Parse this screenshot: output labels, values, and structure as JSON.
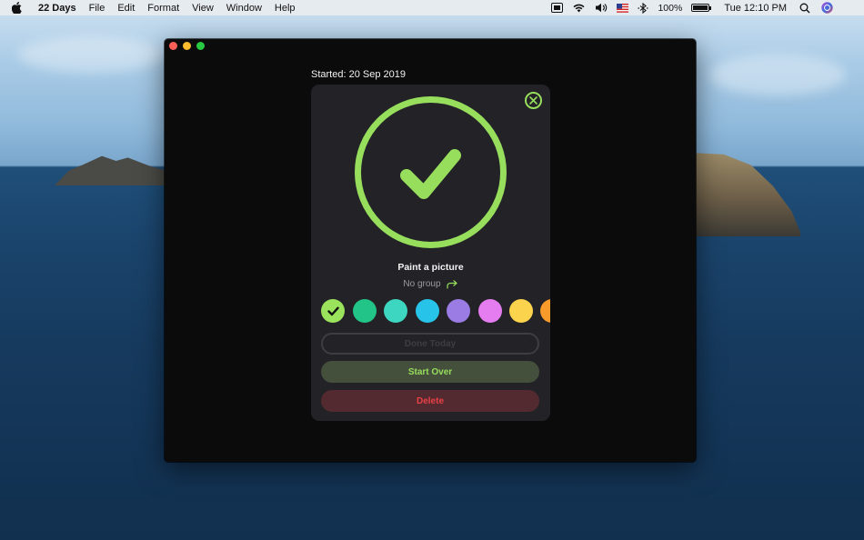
{
  "menubar": {
    "app_name": "22 Days",
    "items": [
      "File",
      "Edit",
      "Format",
      "View",
      "Window",
      "Help"
    ],
    "battery": "100%",
    "clock": "Tue 12:10 PM",
    "icons": [
      "apple-icon",
      "display-icon",
      "wifi-icon",
      "volume-icon",
      "flag-icon",
      "bluetooth-icon",
      "battery-icon",
      "search-icon",
      "siri-icon"
    ]
  },
  "window": {
    "started_label": "Started: 20 Sep 2019"
  },
  "card": {
    "habit_name": "Paint a picture",
    "group_label": "No group",
    "done_today_label": "Done Today",
    "start_over_label": "Start Over",
    "delete_label": "Delete"
  },
  "colors": {
    "accent": "#97de5d",
    "swatches": [
      "#9be35c",
      "#22c487",
      "#3dd6c1",
      "#27c3e8",
      "#9b7be4",
      "#e57cf0",
      "#fcd34d",
      "#f89b2a"
    ],
    "selected_index": 0,
    "delete_text": "#e84147",
    "start_over_bg": "#444f3c"
  }
}
